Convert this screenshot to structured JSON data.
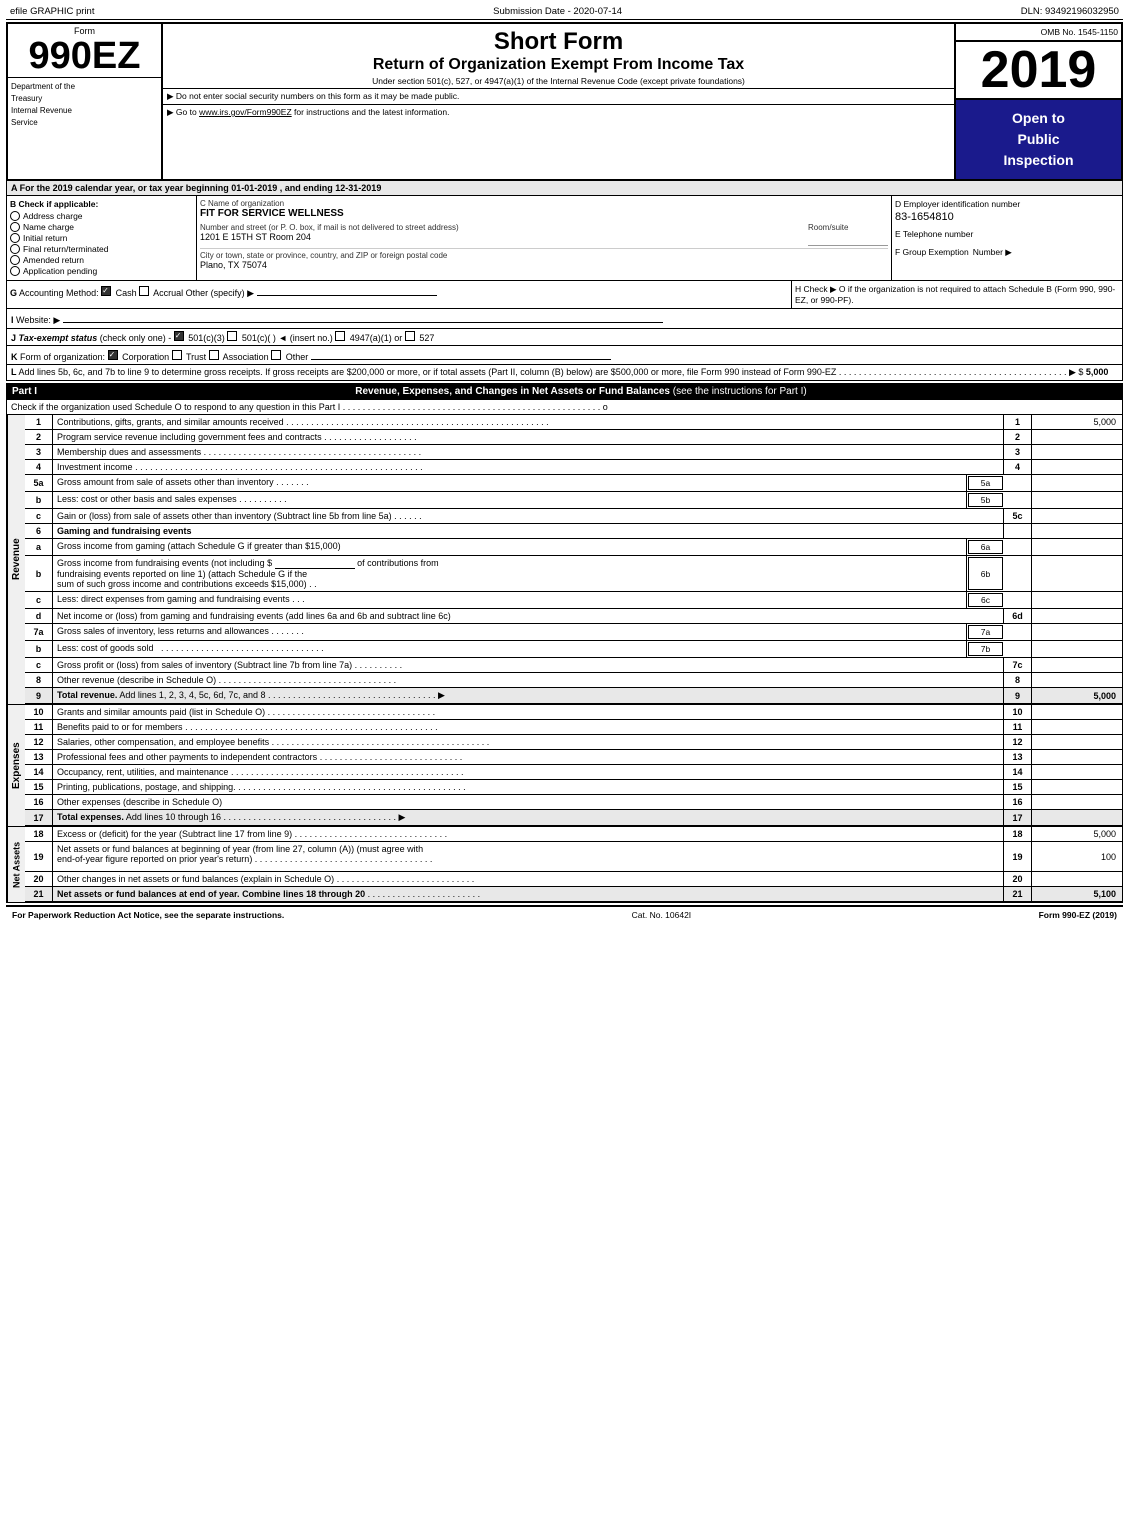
{
  "topBar": {
    "left": "efile GRAPHIC print",
    "center": "Submission Date - 2020-07-14",
    "right": "DLN: 93492196032950"
  },
  "header": {
    "formLabel": "Form",
    "formNumber": "990EZ",
    "deptLine1": "Department of the",
    "deptLine2": "Treasury",
    "deptLine3": "Internal Revenue",
    "deptLine4": "Service",
    "shortFormTitle": "Short Form",
    "returnTitle": "Return of Organization Exempt From Income Tax",
    "underSection": "Under section 501(c), 527, or 4947(a)(1) of the Internal Revenue Code (except private foundations)",
    "noticeLine": "▶ Do not enter social security numbers on this form as it may be made public.",
    "gotoLine": "▶ Go to www.irs.gov/Form990EZ for instructions and the latest information.",
    "ombLabel": "OMB No. 1545-1150",
    "year": "2019",
    "openToPublic": "Open to\nPublic\nInspection"
  },
  "sectionA": {
    "text": "A  For the 2019 calendar year, or tax year beginning 01-01-2019 , and ending 12-31-2019"
  },
  "sectionB": {
    "label": "B  Check if applicable:",
    "items": [
      {
        "id": "address-change",
        "label": "Address charge",
        "checked": false
      },
      {
        "id": "name-change",
        "label": "Name charge",
        "checked": false
      },
      {
        "id": "initial-return",
        "label": "Initial return",
        "checked": false
      },
      {
        "id": "final-return",
        "label": "Final return/terminated",
        "checked": false
      },
      {
        "id": "amended-return",
        "label": "Amended return",
        "checked": false
      },
      {
        "id": "application-pending",
        "label": "Application pending",
        "checked": false
      }
    ]
  },
  "sectionC": {
    "nameLabel": "C Name of organization",
    "orgName": "FIT FOR SERVICE WELLNESS",
    "addressLabel": "Number and street (or P. O. box, if mail is not delivered to street address)",
    "addressValue": "1201 E 15TH ST Room 204",
    "roomLabel": "Room/suite",
    "cityLabel": "City or town, state or province, country, and ZIP or foreign postal code",
    "cityValue": "Plano, TX  75074"
  },
  "sectionD": {
    "label": "D Employer identification number",
    "ein": "83-1654810",
    "phoneLabel": "E Telephone number",
    "phoneValue": "",
    "groupLabel": "F Group Exemption",
    "groupValue": "Number  ▶"
  },
  "sectionG": {
    "label": "G",
    "text": "Accounting Method:",
    "cashChecked": true,
    "accrualChecked": false,
    "otherLabel": "Other (specify) ▶"
  },
  "sectionH": {
    "text": "H  Check ▶  O if the organization is not required to attach Schedule B (Form 990, 990-EZ, or 990-PF)."
  },
  "sectionI": {
    "label": "I",
    "text": "Website: ▶"
  },
  "sectionJ": {
    "label": "J",
    "text": "Tax-exempt status (check only one) -",
    "option1": "501(c)(3)",
    "option1Checked": true,
    "option2": "501(c)(  )",
    "option2Checked": false,
    "insertLabel": "(insert no.)",
    "option3": "4947(a)(1) or",
    "option3Checked": false,
    "option4": "527",
    "option4Checked": false
  },
  "sectionK": {
    "label": "K",
    "text": "Form of organization:",
    "corporation": "Corporation",
    "corporationChecked": true,
    "trust": "Trust",
    "trustChecked": false,
    "association": "Association",
    "associationChecked": false,
    "other": "Other"
  },
  "sectionL": {
    "label": "L",
    "text": "Add lines 5b, 6c, and 7b to line 9 to determine gross receipts. If gross receipts are $200,000 or more, or if total assets (Part II, column (B) below) are $500,000 or more, file Form 990 instead of Form 990-EZ",
    "dots": ". . . . . . . . . . . . . . . . . . . . . . . . . . . . . . . . . . . . . . . . . . . . . .",
    "arrow": "▶ $",
    "value": "5,000"
  },
  "partI": {
    "label": "Part I",
    "title": "Revenue, Expenses, and Changes in Net Assets or Fund Balances",
    "subtitle": "(see the instructions for Part I)",
    "checkLine": "Check if the organization used Schedule O to respond to any question in this Part I",
    "dots": ". . . . . . . . . . . . . . . . . . . . . . . . . . . . . . . . .",
    "checkBox": "o"
  },
  "revenueRows": [
    {
      "num": "1",
      "desc": "Contributions, gifts, grants, and similar amounts received",
      "dots": ". . . . . . . . . . . . . . . . . . . . . . . . . . . . . . . . .",
      "lineNum": "1",
      "amount": "5,000"
    },
    {
      "num": "2",
      "desc": "Program service revenue including government fees and contracts",
      "dots": ". . . . . . . . . . . . . . . . . .",
      "lineNum": "2",
      "amount": ""
    },
    {
      "num": "3",
      "desc": "Membership dues and assessments",
      "dots": ". . . . . . . . . . . . . . . . . . . . . . . . . . . . . . . . . . . . . . . . . . . . .",
      "lineNum": "3",
      "amount": ""
    },
    {
      "num": "4",
      "desc": "Investment income",
      "dots": ". . . . . . . . . . . . . . . . . . . . . . . . . . . . . . . . . . . . . . . . . . . . . . . . . . . . . . . .",
      "lineNum": "4",
      "amount": ""
    }
  ],
  "row5a": {
    "num": "5a",
    "desc": "Gross amount from sale of assets other than inventory",
    "dots": ". . . . . . .",
    "ref": "5a",
    "amount": ""
  },
  "row5b": {
    "num": "b",
    "desc": "Less: cost or other basis and sales expenses",
    "dots": ". . . . . . . . . .",
    "ref": "5b",
    "amount": ""
  },
  "row5c": {
    "num": "c",
    "desc": "Gain or (loss) from sale of assets other than inventory (Subtract line 5b from line 5a)",
    "dots": ". . . . . .",
    "lineNum": "5c",
    "amount": ""
  },
  "row6": {
    "num": "6",
    "desc": "Gaming and fundraising events",
    "a": {
      "num": "a",
      "desc": "Gross income from gaming (attach Schedule G if greater than $15,000)",
      "ref": "6a"
    },
    "b": {
      "num": "b",
      "desc": "Gross income from fundraising events (not including $",
      "blank": "_______________",
      "of": "of contributions from",
      "desc2": "fundraising events reported on line 1) (attach Schedule G if the",
      "desc3": "sum of such gross income and contributions exceeds $15,000)",
      "dots": ". .",
      "ref": "6b"
    },
    "c": {
      "num": "c",
      "desc": "Less: direct expenses from gaming and fundraising events",
      "dots": ". . .",
      "ref": "6c"
    },
    "d": {
      "num": "d",
      "desc": "Net income or (loss) from gaming and fundraising events (add lines 6a and 6b and subtract line 6c)",
      "lineNum": "6d",
      "amount": ""
    }
  },
  "row7a": {
    "num": "7a",
    "desc": "Gross sales of inventory, less returns and allowances",
    "dots": ". . . . . . .",
    "ref": "7a",
    "amount": ""
  },
  "row7b": {
    "num": "b",
    "desc": "Less: cost of goods sold",
    "dots": ". . . . . . . . . . . . . . . . . . . . . . . . . . . . . . . . . . . . . .",
    "ref": "7b",
    "amount": ""
  },
  "row7c": {
    "num": "c",
    "desc": "Gross profit or (loss) from sales of inventory (Subtract line 7b from line 7a)",
    "dots": ". . . . . . . . . .",
    "lineNum": "7c",
    "amount": ""
  },
  "row8": {
    "num": "8",
    "desc": "Other revenue (describe in Schedule O)",
    "dots": ". . . . . . . . . . . . . . . . . . . . . . . . . . . . . . . . . . . . .",
    "lineNum": "8",
    "amount": ""
  },
  "row9": {
    "num": "9",
    "desc": "Total revenue. Add lines 1, 2, 3, 4, 5c, 6d, 7c, and 8",
    "dots": ". . . . . . . . . . . . . . . . . . . . . . . . . . . . . . . . . . .",
    "arrow": "▶",
    "lineNum": "9",
    "amount": "5,000"
  },
  "expenseRows": [
    {
      "num": "10",
      "desc": "Grants and similar amounts paid (list in Schedule O)",
      "dots": ". . . . . . . . . . . . . . . . . . . . . . . . . . . . . . . . . .",
      "lineNum": "10",
      "amount": ""
    },
    {
      "num": "11",
      "desc": "Benefits paid to or for members",
      "dots": ". . . . . . . . . . . . . . . . . . . . . . . . . . . . . . . . . . . . . . . . . . . . . . . . . .",
      "lineNum": "11",
      "amount": ""
    },
    {
      "num": "12",
      "desc": "Salaries, other compensation, and employee benefits",
      "dots": ". . . . . . . . . . . . . . . . . . . . . . . . . . . . . . . . . . . . .",
      "lineNum": "12",
      "amount": ""
    },
    {
      "num": "13",
      "desc": "Professional fees and other payments to independent contractors",
      "dots": ". . . . . . . . . . . . . . . . . . . . . . . . . . . . .",
      "lineNum": "13",
      "amount": ""
    },
    {
      "num": "14",
      "desc": "Occupancy, rent, utilities, and maintenance",
      "dots": ". . . . . . . . . . . . . . . . . . . . . . . . . . . . . . . . . . . . . . . . . . . . . . .",
      "lineNum": "14",
      "amount": ""
    },
    {
      "num": "15",
      "desc": "Printing, publications, postage, and shipping.",
      "dots": ". . . . . . . . . . . . . . . . . . . . . . . . . . . . . . . . . . . . . . . . . . . . . .",
      "lineNum": "15",
      "amount": ""
    },
    {
      "num": "16",
      "desc": "Other expenses (describe in Schedule O)",
      "lineNum": "16",
      "amount": ""
    },
    {
      "num": "17",
      "desc": "Total expenses. Add lines 10 through 16",
      "dots": ". . . . . . . . . . . . . . . . . . . . . . . . . . . . . . . . . . . .",
      "arrow": "▶",
      "lineNum": "17",
      "amount": ""
    }
  ],
  "netAssetsRows": [
    {
      "num": "18",
      "desc": "Excess or (deficit) for the year (Subtract line 17 from line 9)",
      "dots": ". . . . . . . . . . . . . . . . . . . . . . . . . . . . . . .",
      "lineNum": "18",
      "amount": "5,000"
    },
    {
      "num": "19",
      "desc": "Net assets or fund balances at beginning of year (from line 27, column (A)) (must agree with",
      "desc2": "end-of-year figure reported on prior year's return)",
      "dots": ". . . . . . . . . . . . . . . . . . . . . . . . . . . . . . . . . . . .",
      "lineNum": "19",
      "amount": "100"
    },
    {
      "num": "20",
      "desc": "Other changes in net assets or fund balances (explain in Schedule O)",
      "dots": ". . . . . . . . . . . . . . . . . . . . . . . . . . . .",
      "lineNum": "20",
      "amount": ""
    },
    {
      "num": "21",
      "desc": "Net assets or fund balances at end of year. Combine lines 18 through 20",
      "dots": ". . . . . . . . . . . . . . . . . . . . . . . .",
      "lineNum": "21",
      "amount": "5,100"
    }
  ],
  "footer": {
    "left": "For Paperwork Reduction Act Notice, see the separate instructions.",
    "center": "Cat. No. 10642I",
    "right": "Form 990-EZ (2019)"
  }
}
